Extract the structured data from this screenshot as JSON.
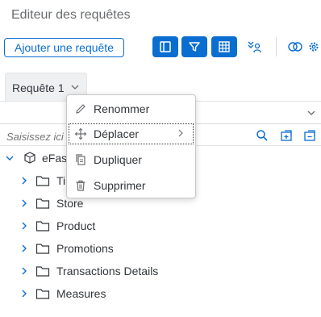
{
  "header": {
    "title": "Editeur des requêtes"
  },
  "toolbar": {
    "add_query_label": "Ajouter une requête",
    "icons": [
      "panel-icon",
      "filter-icon",
      "grid-icon",
      "hierarchy-users-icon",
      "linked-circles-icon",
      "settings-icon"
    ]
  },
  "tabs": [
    {
      "label": "Requête 1"
    }
  ],
  "search": {
    "placeholder": "Saisissez ici"
  },
  "tree": {
    "root": {
      "label": "eFash"
    },
    "children": [
      {
        "label": "Time"
      },
      {
        "label": "Store"
      },
      {
        "label": "Product"
      },
      {
        "label": "Promotions"
      },
      {
        "label": "Transactions Details"
      },
      {
        "label": "Measures"
      }
    ]
  },
  "context_menu": {
    "items": [
      {
        "label": "Renommer",
        "icon": "pencil-icon"
      },
      {
        "label": "Déplacer",
        "icon": "move-icon",
        "has_submenu": true
      },
      {
        "label": "Dupliquer",
        "icon": "copy-icon"
      },
      {
        "label": "Supprimer",
        "icon": "trash-icon"
      }
    ]
  },
  "colors": {
    "accent": "#0a6ed1",
    "text": "#32363a",
    "muted": "#6a6d70"
  }
}
